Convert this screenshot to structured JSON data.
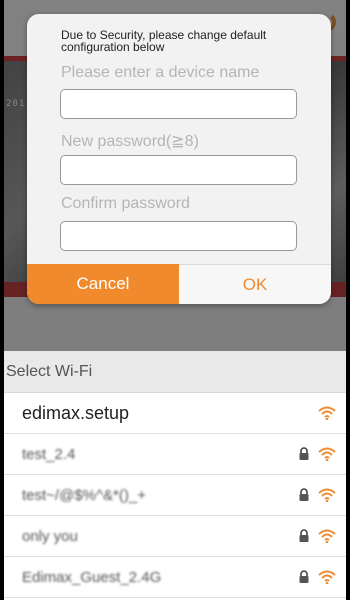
{
  "dialog": {
    "message": "Due to Security, please change default configuration below",
    "device_name_placeholder": "Please enter a device name",
    "new_password_placeholder": "New password(≧8)",
    "confirm_password_placeholder": "Confirm password",
    "cancel_label": "Cancel",
    "ok_label": "OK"
  },
  "video": {
    "timestamp": "201"
  },
  "wifi": {
    "header": "Select Wi-Fi",
    "networks": [
      {
        "ssid": "edimax.setup",
        "secured": false
      },
      {
        "ssid": "test_2.4",
        "secured": true
      },
      {
        "ssid": "test~/@$%^&*()_+",
        "secured": true
      },
      {
        "ssid": "only you",
        "secured": true
      },
      {
        "ssid": "Edimax_Guest_2.4G",
        "secured": true
      }
    ]
  },
  "colors": {
    "accent": "#f08a2c",
    "header_red": "#d0262b"
  },
  "icons": {
    "refresh": "refresh-icon",
    "lock": "lock-icon",
    "wifi": "wifi-icon"
  }
}
